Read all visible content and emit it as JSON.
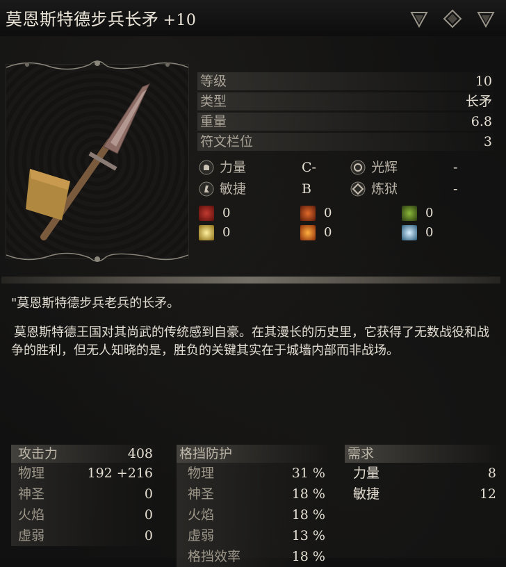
{
  "title": {
    "name": "莫恩斯特德步兵长矛",
    "upgrade": "+10"
  },
  "stats": [
    {
      "label": "等级",
      "value": "10"
    },
    {
      "label": "类型",
      "value": "长矛"
    },
    {
      "label": "重量",
      "value": "6.8"
    },
    {
      "label": "符文栏位",
      "value": "3"
    }
  ],
  "scaling": [
    {
      "name": "力量",
      "grade": "C-",
      "icon": "strength-icon"
    },
    {
      "name": "光辉",
      "grade": "-",
      "icon": "radiance-icon"
    },
    {
      "name": "敏捷",
      "grade": "B",
      "icon": "dexterity-icon"
    },
    {
      "name": "炼狱",
      "grade": "-",
      "icon": "purgatory-icon"
    }
  ],
  "status_effects": [
    {
      "icon": "bleed-icon",
      "value": "0",
      "color": "#8a1a14"
    },
    {
      "icon": "fire-status-icon",
      "value": "0",
      "color": "#b3401a"
    },
    {
      "icon": "poison-icon",
      "value": "0",
      "color": "#4f7a1c"
    },
    {
      "icon": "lightning-icon",
      "value": "0",
      "color": "#d9b23a"
    },
    {
      "icon": "explosion-icon",
      "value": "0",
      "color": "#d4581c"
    },
    {
      "icon": "frost-icon",
      "value": "0",
      "color": "#6fb4d8"
    }
  ],
  "description": {
    "line1": "\"莫恩斯特德步兵老兵的长矛。",
    "line2": "莫恩斯特德王国对其尚武的传统感到自豪。在其漫长的历史里，它获得了无数战役和战争的胜利，但无人知晓的是，胜负的关键其实在于城墙内部而非战场。"
  },
  "attack": {
    "header": "攻击力",
    "header_value": "408",
    "rows": [
      {
        "label": "物理",
        "value": "192 +216"
      },
      {
        "label": "神圣",
        "value": "0"
      },
      {
        "label": "火焰",
        "value": "0"
      },
      {
        "label": "虚弱",
        "value": "0"
      }
    ]
  },
  "guard": {
    "header": "格挡防护",
    "rows": [
      {
        "label": "物理",
        "value": "31 %"
      },
      {
        "label": "神圣",
        "value": "18 %"
      },
      {
        "label": "火焰",
        "value": "18 %"
      },
      {
        "label": "虚弱",
        "value": "13 %"
      },
      {
        "label": "格挡效率",
        "value": "18 %"
      }
    ]
  },
  "requirements": {
    "header": "需求",
    "rows": [
      {
        "label": "力量",
        "value": "8"
      },
      {
        "label": "敏捷",
        "value": "12"
      }
    ]
  },
  "icons": {
    "top_right": [
      "triangle-down-icon",
      "diamond-icon",
      "triangle-down-icon"
    ]
  }
}
